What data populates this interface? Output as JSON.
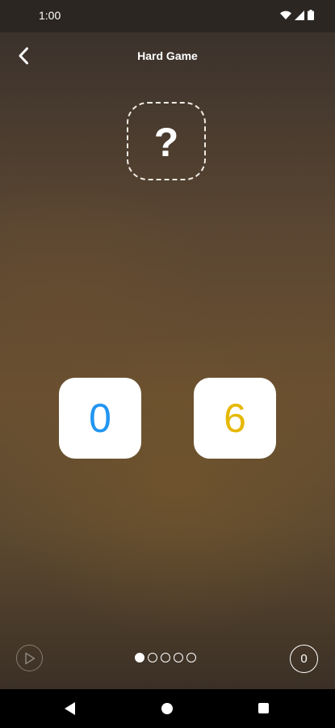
{
  "status_bar": {
    "time": "1:00",
    "icons": [
      "wifi-icon",
      "signal-icon",
      "battery-icon"
    ]
  },
  "header": {
    "title": "Hard Game",
    "back_icon": "chevron-left-icon"
  },
  "target": {
    "symbol": "?"
  },
  "cards": [
    {
      "value": "0",
      "color": "#2196f3"
    },
    {
      "value": "6",
      "color": "#e6b800"
    }
  ],
  "pager": {
    "total": 5,
    "active_index": 0
  },
  "score": {
    "value": "0"
  },
  "bottom_left": {
    "icon": "play-icon"
  },
  "nav_bar": {
    "icons": [
      "back-triangle-icon",
      "home-circle-icon",
      "recents-square-icon"
    ]
  }
}
